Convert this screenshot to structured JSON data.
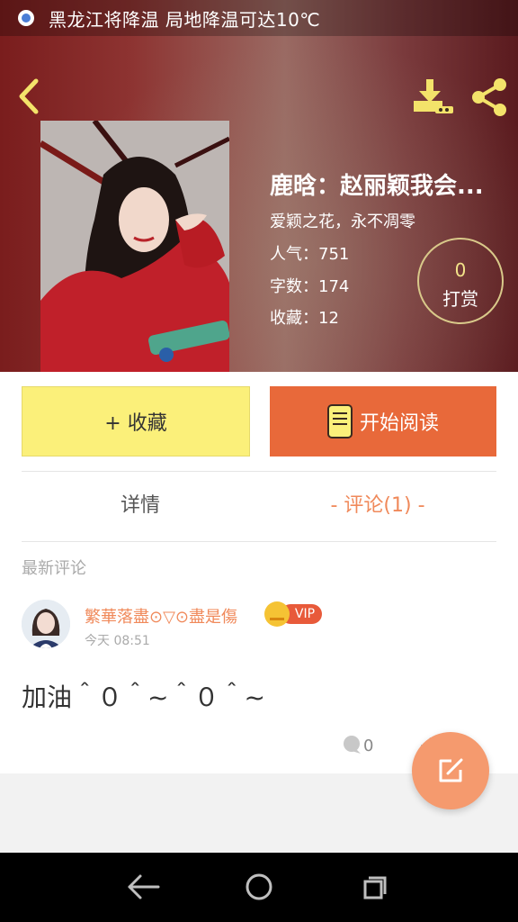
{
  "status_bar": {
    "notification_icon": "weather-app-icon",
    "text": "黑龙江将降温 局地降温可达10℃"
  },
  "header": {
    "back_icon": "chevron-left-icon",
    "download_icon": "download-icon",
    "share_icon": "share-icon"
  },
  "book": {
    "title": "鹿晗：赵丽颖我会...",
    "subtitle": "爱颖之花，永不凋零",
    "stats": [
      {
        "label": "人气：751"
      },
      {
        "label": "字数：174"
      },
      {
        "label": "收藏：12"
      }
    ]
  },
  "tip": {
    "count": "0",
    "label": "打赏"
  },
  "actions": {
    "favorite_label": "+ 收藏",
    "read_label": "开始阅读",
    "favorite_color": "#fbf07a",
    "read_color": "#e8693a"
  },
  "tabs": [
    {
      "label": "详情"
    },
    {
      "label": "- 评论(1) -"
    }
  ],
  "comments_section": {
    "title": "最新评论",
    "items": [
      {
        "username": "繁華落盡⊙▽⊙盡是傷",
        "badge": "VIP",
        "time": "今天 08:51",
        "text": "加油＾０＾~＾０＾~",
        "reply_count": "0"
      }
    ]
  },
  "fab": {
    "icon": "edit-icon"
  },
  "nav_bar": {
    "back_icon": "nav-back-icon",
    "home_icon": "nav-home-icon",
    "recent_icon": "nav-recent-icon"
  }
}
